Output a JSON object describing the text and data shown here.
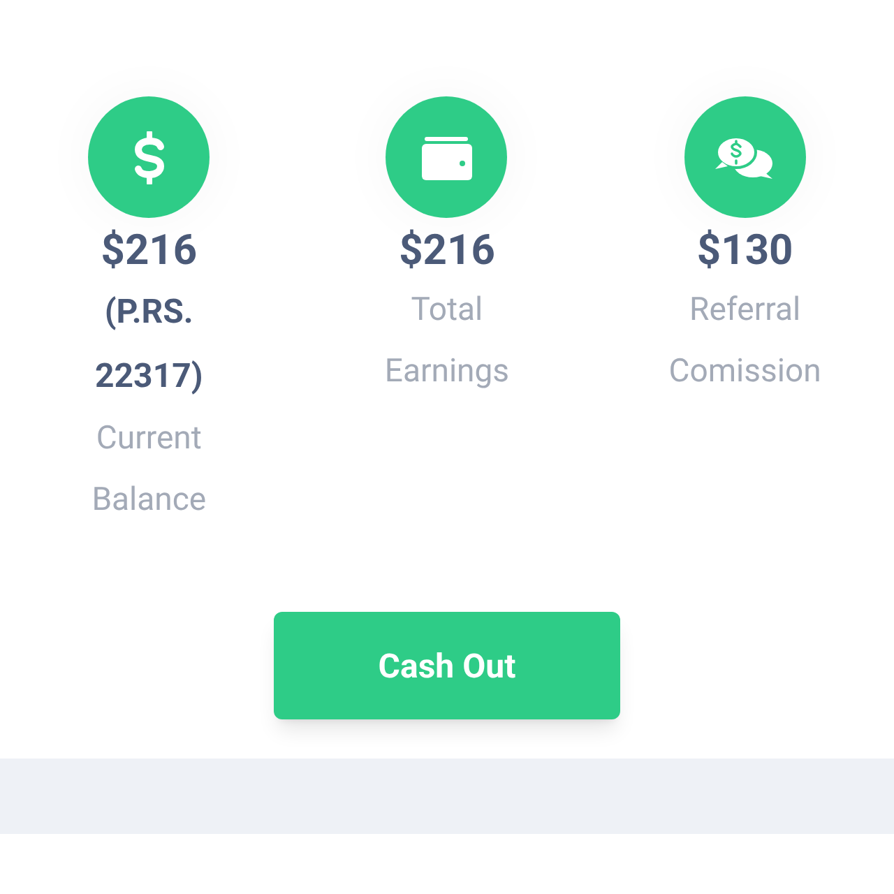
{
  "stats": [
    {
      "kind": "dollar",
      "amount": "$216",
      "note": "(P.RS. 22317)",
      "label": "Current Balance"
    },
    {
      "kind": "wallet",
      "amount": "$216",
      "label": "Total Earnings"
    },
    {
      "kind": "chat",
      "amount": "$130",
      "label": "Referral Comission"
    }
  ],
  "cash_out_button": {
    "label": "Cash Out"
  }
}
